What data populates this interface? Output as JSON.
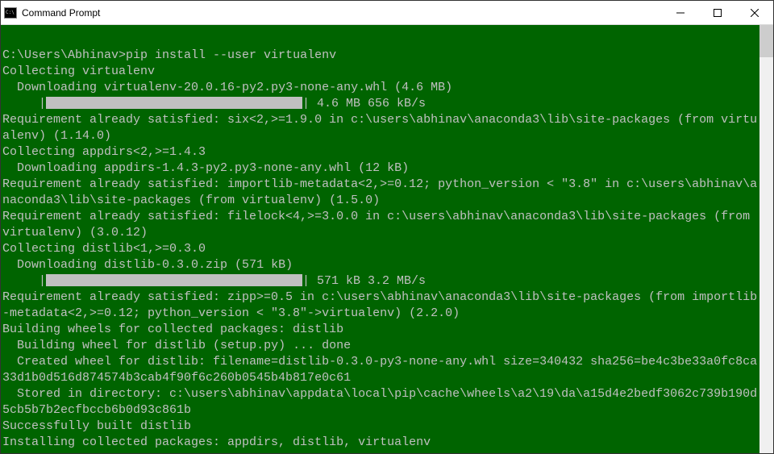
{
  "window": {
    "title": "Command Prompt"
  },
  "terminal": {
    "prompt": "C:\\Users\\Abhinav>",
    "command": "pip install --user virtualenv",
    "lines": {
      "l1": "Collecting virtualenv",
      "l2": "  Downloading virtualenv-20.0.16-py2.py3-none-any.whl (4.6 MB)",
      "l3a": "     |",
      "l3b": "| 4.6 MB 656 kB/s",
      "l4": "Requirement already satisfied: six<2,>=1.9.0 in c:\\users\\abhinav\\anaconda3\\lib\\site-packages (from virtualenv) (1.14.0)",
      "l5": "Collecting appdirs<2,>=1.4.3",
      "l6": "  Downloading appdirs-1.4.3-py2.py3-none-any.whl (12 kB)",
      "l7": "Requirement already satisfied: importlib-metadata<2,>=0.12; python_version < \"3.8\" in c:\\users\\abhinav\\anaconda3\\lib\\site-packages (from virtualenv) (1.5.0)",
      "l8": "Requirement already satisfied: filelock<4,>=3.0.0 in c:\\users\\abhinav\\anaconda3\\lib\\site-packages (from virtualenv) (3.0.12)",
      "l9": "Collecting distlib<1,>=0.3.0",
      "l10": "  Downloading distlib-0.3.0.zip (571 kB)",
      "l11a": "     |",
      "l11b": "| 571 kB 3.2 MB/s",
      "l12": "Requirement already satisfied: zipp>=0.5 in c:\\users\\abhinav\\anaconda3\\lib\\site-packages (from importlib-metadata<2,>=0.12; python_version < \"3.8\"->virtualenv) (2.2.0)",
      "l13": "Building wheels for collected packages: distlib",
      "l14": "  Building wheel for distlib (setup.py) ... done",
      "l15": "  Created wheel for distlib: filename=distlib-0.3.0-py3-none-any.whl size=340432 sha256=be4c3be33a0fc8ca33d1b0d516d874574b3cab4f90f6c260b0545b4b817e0c61",
      "l16": "  Stored in directory: c:\\users\\abhinav\\appdata\\local\\pip\\cache\\wheels\\a2\\19\\da\\a15d4e2bedf3062c739b190d5cb5b7b2ecfbccb6b0d93c861b",
      "l17": "Successfully built distlib",
      "l18": "Installing collected packages: appdirs, distlib, virtualenv"
    }
  }
}
